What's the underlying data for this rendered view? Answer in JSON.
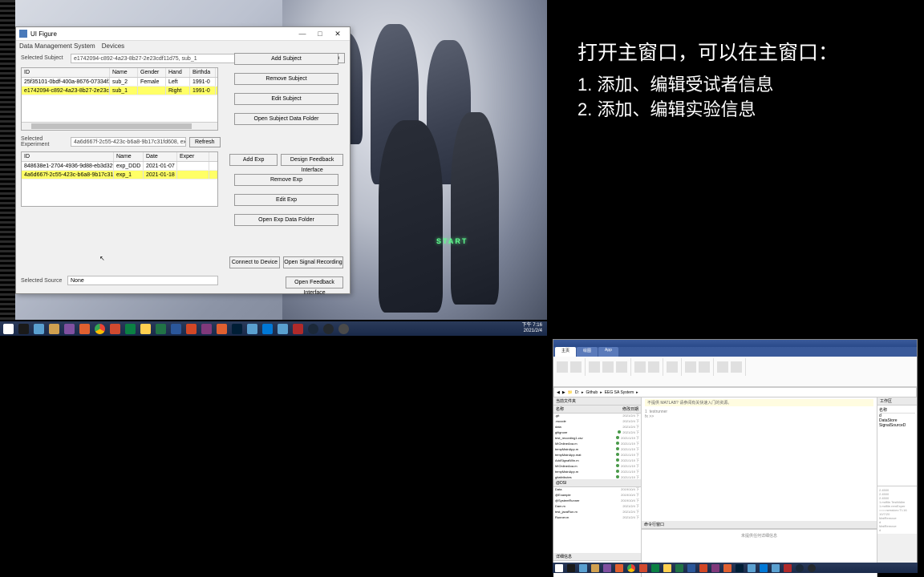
{
  "desktop": {
    "start_text": "START"
  },
  "uifig": {
    "title": "UI Figure",
    "menu": {
      "m1": "Data Management System",
      "m2": "Devices"
    },
    "sel_subject_lbl": "Selected Subject",
    "sel_subject_val": "e1742094-c892-4a23-8b27-2e23cdf11d75, sub_1",
    "refresh": "Refresh",
    "subjects": {
      "cols": {
        "id": "ID",
        "name": "Name",
        "gender": "Gender",
        "hand": "Hand",
        "birth": "Birthda"
      },
      "rows": [
        {
          "id": "25f35101-0bdf-400a-8676-07334f3cfd14",
          "name": "sub_2",
          "gender": "Female",
          "hand": "Left",
          "birth": "1991-0"
        },
        {
          "id": "e1742094-c892-4a23-8b27-2e23cdf11d...",
          "name": "sub_1",
          "gender": "",
          "hand": "Right",
          "birth": "1991-0"
        }
      ]
    },
    "add_subject": "Add Subject",
    "remove_subject": "Remove Subject",
    "edit_subject": "Edit Subject",
    "open_subject_folder": "Open Subject Data Folder",
    "sel_exp_lbl": "Selected Experiment",
    "sel_exp_val": "4a6d667f-2c55-423c-b6a8-9b17c31fd608, exp_1, 20...",
    "exps": {
      "cols": {
        "id": "ID",
        "name": "Name",
        "date": "Date",
        "exper": "Exper"
      },
      "rows": [
        {
          "id": "848638e1-2704-4936-9d88-eb3d32f15e7a",
          "name": "exp_DDD",
          "date": "2021-01-07",
          "exper": ""
        },
        {
          "id": "4a6d667f-2c55-423c-b6a8-9b17c31fd608",
          "name": "exp_1",
          "date": "2021-01-18",
          "exper": ""
        }
      ]
    },
    "add_exp": "Add Exp",
    "design_fb": "Design Feedback Interface",
    "remove_exp": "Remove Exp",
    "edit_exp": "Edit Exp",
    "open_exp_folder": "Open Exp Data Folder",
    "sel_src_lbl": "Selected Source",
    "sel_src_val": "None",
    "connect_dev": "Connect to Device",
    "open_signal": "Open Signal Recording",
    "open_feedback": "Open Feedback Interface"
  },
  "taskbar": {
    "time": "下午 7:16",
    "date": "2021/2/4",
    "colors": [
      "#fff",
      "#1a1a1a",
      "#5aa0d0",
      "#d0a050",
      "#8050a0",
      "#e06030",
      "#ffd050",
      "#0b8043",
      "#d04a30",
      "#3060b0",
      "#e07030",
      "#6040a0",
      "#b05aa0",
      "#e06030",
      "#5aa0d0",
      "#3060b0",
      "#5aa0d0",
      "#b02a2a",
      "#3a3a3a",
      "#2a2a2a",
      "#4a4a4a"
    ]
  },
  "text_tr": {
    "line1": "打开主窗口，可以在主窗口：",
    "line2a": "1. 添加、编辑受试者信息",
    "line2b": "2. 添加、编辑实验信息"
  },
  "matlab": {
    "tabs": [
      "主页",
      "绘图",
      "App"
    ],
    "path_segs": [
      "D:",
      "Github",
      "EEG SA System"
    ],
    "left_title": "当前文件夹",
    "col_name": "名称",
    "col_date": "修改日期",
    "files": [
      {
        "n": ".git",
        "d": "2021/2/4 下",
        "g": 0
      },
      {
        "n": ".vscode",
        "d": "2021/2/4 下",
        "g": 0
      },
      {
        "n": "data",
        "d": "2021/2/4 下",
        "g": 0
      },
      {
        "n": "gitignore",
        "d": "2021/2/4 下",
        "g": 1
      },
      {
        "n": "test_recording1.csv",
        "d": "2021/1/19 下",
        "g": 1
      },
      {
        "n": "MIOnlineAna.m",
        "d": "2021/1/19 下",
        "g": 1
      },
      {
        "n": "tempMainApp.m",
        "d": "2021/1/19 下",
        "g": 1
      },
      {
        "n": "tempMainApp.mat",
        "d": "2021/1/19 下",
        "g": 1
      },
      {
        "n": "AddSignalWin.m",
        "d": "2021/1/19 下",
        "g": 1
      },
      {
        "n": "MIOnlineAna.m",
        "d": "2021/1/19 下",
        "g": 1
      },
      {
        "n": "tempMainApp.m",
        "d": "2021/1/19 下",
        "g": 1
      },
      {
        "n": "gitattributes",
        "d": "2021/1/19 下",
        "g": 1
      }
    ],
    "files2_title": "@DSI",
    "files2": [
      {
        "n": "Data",
        "d": "2019/10/4 下"
      },
      {
        "n": "@Example",
        "d": "2019/10/4 下"
      },
      {
        "n": "@SystemRunner",
        "d": "2019/10/4 下"
      },
      {
        "n": "Dam.m",
        "d": "2021/2/4 下"
      },
      {
        "n": "test_javaRun.m",
        "d": "2021/2/4 下"
      },
      {
        "n": "Runner.m",
        "d": "2021/2/4 下"
      }
    ],
    "details": "详细信息",
    "editor_hint": "不提供 MATLAB? 请参阅有关快速入门的资源。",
    "cmd_prompt": "fx >>",
    "cmd_line": "testrunner",
    "cmd_title": "命令行窗口",
    "bottom_hint": "未提供任何详细信息",
    "ws_title": "工作区",
    "ws_cols": "名称",
    "ws_items": [
      "d",
      "DataStore",
      "SignalSourceD"
    ],
    "hist_items": [
      "2.4500",
      "2.4500",
      "2.4500",
      "1.mdfile.TestMdlm",
      "1.mdfile.remExper",
      "====session=TI-16",
      "10/7/20",
      "MatRemove",
      "d",
      "MatRemove",
      "d"
    ]
  }
}
